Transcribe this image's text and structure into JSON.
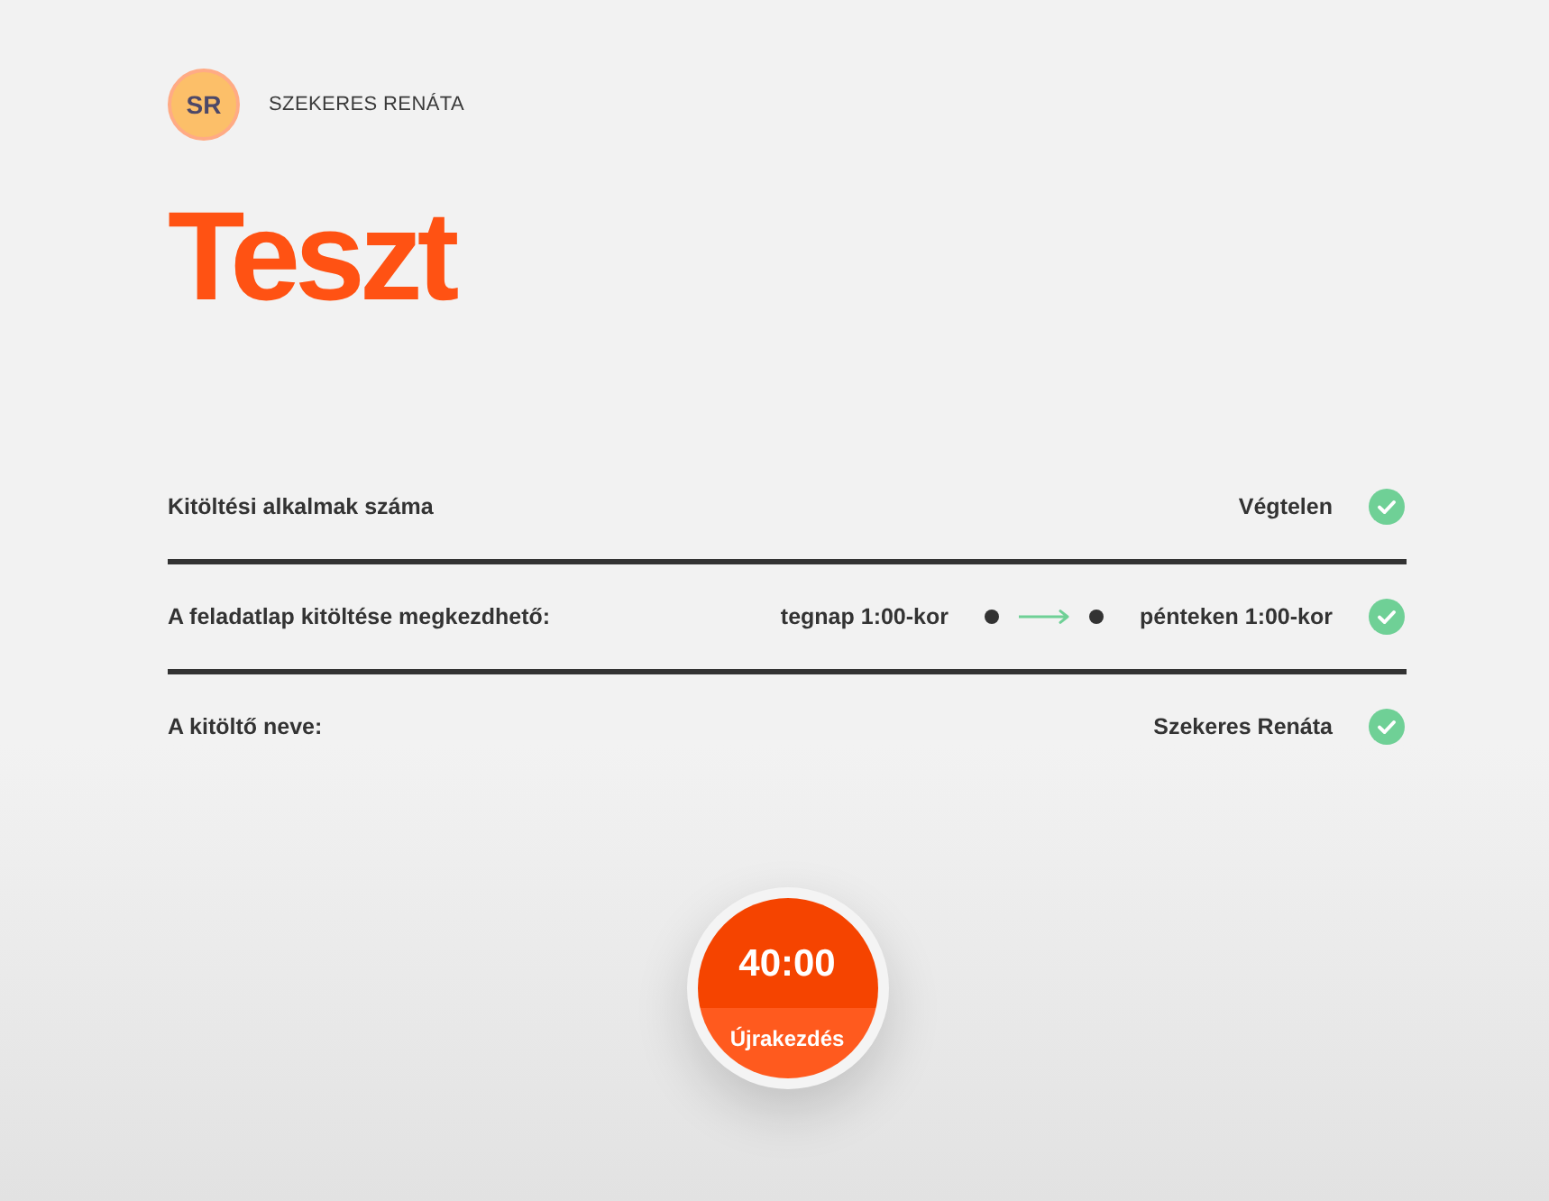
{
  "user": {
    "initials": "SR",
    "name": "SZEKERES RENÁTA"
  },
  "title": "Teszt",
  "rows": [
    {
      "kind": "text",
      "label": "Kitöltési alkalmak száma",
      "value": "Végtelen",
      "valid": true
    },
    {
      "kind": "range",
      "label": "A feladatlap kitöltése megkezdhető:",
      "from": "tegnap 1:00-kor",
      "to": "pénteken 1:00-kor",
      "valid": true
    },
    {
      "kind": "text",
      "label": "A kitöltő neve:",
      "value": "Szekeres Renáta",
      "valid": true
    }
  ],
  "timer": {
    "time": "40:00",
    "action": "Újrakezdés"
  }
}
